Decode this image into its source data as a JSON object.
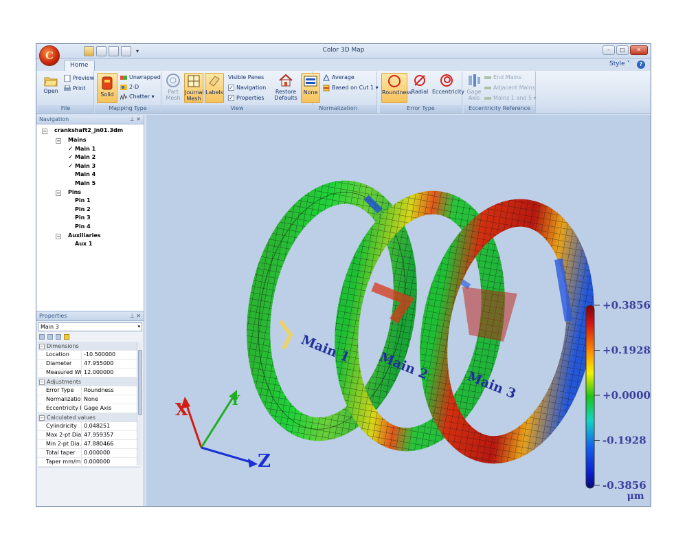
{
  "window": {
    "title": "Color 3D Map"
  },
  "app_orb_letter": "C",
  "tabs": {
    "home": "Home",
    "style_menu": "Style"
  },
  "ribbon": {
    "file": {
      "label": "File",
      "open": "Open",
      "preview": "Preview",
      "print": "Print"
    },
    "mapping_type": {
      "label": "Mapping Type",
      "solid": "Solid",
      "unwrapped": "Unwrapped",
      "two_d": "2-D",
      "chatter": "Chatter"
    },
    "view": {
      "label": "View",
      "part_mesh": "Part Mesh",
      "journal_mesh": "Journal Mesh",
      "labels": "Labels",
      "visible_panes": "Visible Panes",
      "navigation": "Navigation",
      "properties": "Properties",
      "restore_defaults": "Restore Defaults"
    },
    "normalization": {
      "label": "Normalization",
      "none": "None",
      "average": "Average",
      "based_on_cut": "Based on Cut 1"
    },
    "error_type": {
      "label": "Error Type",
      "roundness": "Roundness",
      "radial": "Radial",
      "eccentricity": "Eccentricity"
    },
    "eccentricity_reference": {
      "label": "Eccentricity Reference",
      "gage_axis": "Gage Axis",
      "end_mains": "End Mains",
      "adjacent_mains": "Adjacent Mains",
      "mains_1_and_5": "Mains 1 and 5"
    }
  },
  "navigation": {
    "title": "Navigation",
    "root": "crankshaft2_jn01.3dm",
    "groups": [
      {
        "label": "Mains",
        "items": [
          {
            "label": "Main 1",
            "checked": true
          },
          {
            "label": "Main 2",
            "checked": true
          },
          {
            "label": "Main 3",
            "checked": true
          },
          {
            "label": "Main 4",
            "checked": false
          },
          {
            "label": "Main 5",
            "checked": false
          }
        ]
      },
      {
        "label": "Pins",
        "items": [
          {
            "label": "Pin 1",
            "checked": false
          },
          {
            "label": "Pin 2",
            "checked": false
          },
          {
            "label": "Pin 3",
            "checked": false
          },
          {
            "label": "Pin 4",
            "checked": false
          }
        ]
      },
      {
        "label": "Auxiliaries",
        "items": [
          {
            "label": "Aux 1",
            "checked": false
          }
        ]
      }
    ]
  },
  "properties": {
    "title": "Properties",
    "selected_object": "Main 3",
    "categories": [
      {
        "name": "Dimensions",
        "rows": [
          {
            "name": "Location",
            "value": "-10.500000"
          },
          {
            "name": "Diameter",
            "value": "47.955000"
          },
          {
            "name": "Measured Wi...",
            "value": "12.000000"
          }
        ]
      },
      {
        "name": "Adjustments",
        "rows": [
          {
            "name": "Error Type",
            "value": "Roundness"
          },
          {
            "name": "Normalization",
            "value": "None"
          },
          {
            "name": "Eccentricity R...",
            "value": "Gage Axis"
          }
        ]
      },
      {
        "name": "Calculated values",
        "rows": [
          {
            "name": "Cylindricity",
            "value": "0.048251"
          },
          {
            "name": "Max 2-pt Dia...",
            "value": "47.959357"
          },
          {
            "name": "Min 2-pt Dia...",
            "value": "47.880466"
          },
          {
            "name": "Total taper",
            "value": "0.000000"
          },
          {
            "name": "Taper mm/mm",
            "value": "0.000000"
          }
        ]
      }
    ]
  },
  "viewport": {
    "journal_labels": [
      "Main 1",
      "Main 2",
      "Main 3"
    ],
    "axes": {
      "x": "X",
      "y": "Y",
      "z": "Z"
    },
    "colorbar": {
      "ticks": [
        "+0.3856",
        "+0.1928",
        "+0.0000",
        "-0.1928",
        "-0.3856"
      ],
      "unit": "μm"
    }
  },
  "colors": {
    "background": "#bccfe6",
    "scale_text": "#3b3f9e",
    "axis_x": "#d41d12",
    "axis_y": "#1fae22",
    "axis_z": "#1a2fd6"
  }
}
